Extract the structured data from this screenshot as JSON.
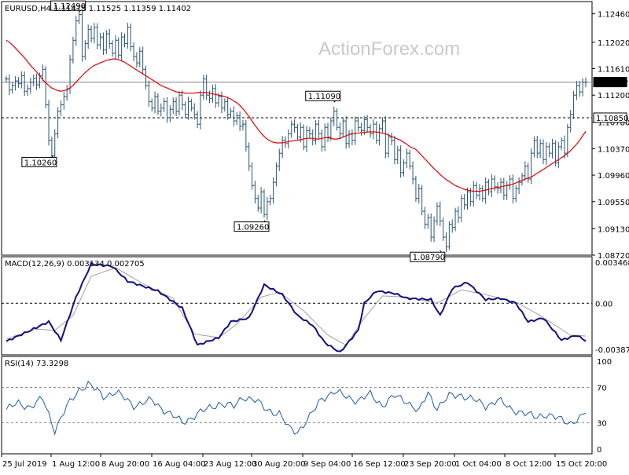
{
  "chart_data": [
    {
      "type": "ohlc",
      "panel": "price",
      "symbol_header": "EURUSD,H4  1.11475 1.11525 1.11359 1.11402",
      "watermark": "ActionForex.com",
      "ylim": [
        1.0872,
        1.1265
      ],
      "y_ticks": [
        1.1246,
        1.1202,
        1.1161,
        1.112,
        1.1078,
        1.1037,
        1.0996,
        1.0955,
        1.0913,
        1.0872
      ],
      "y_tick_labels": [
        "1.12460",
        "1.12020",
        "1.11610",
        "1.11200",
        "1.10780",
        "1.10370",
        "1.09960",
        "1.09550",
        "1.09130",
        "1.08720"
      ],
      "x_tick_labels": [
        "25 Jul 2019",
        "1 Aug 12:00",
        "8 Aug 20:00",
        "16 Aug 04:00",
        "23 Aug 12:00",
        "30 Aug 20:00",
        "9 Sep 04:00",
        "16 Sep 12:00",
        "23 Sep 20:00",
        "1 Oct 04:00",
        "8 Oct 12:00",
        "15 Oct 20:00"
      ],
      "price_tags": [
        {
          "label": "1.11402",
          "value": 1.11402,
          "style": "filled"
        },
        {
          "label": "1.10850",
          "value": 1.1085,
          "style": "outline"
        }
      ],
      "horizontal_lines": [
        {
          "value": 1.11402,
          "style": "solid",
          "color": "#808080"
        },
        {
          "value": 1.1085,
          "style": "dashed",
          "color": "#000000"
        }
      ],
      "annotations": [
        {
          "label": "1.12490",
          "bar": 24,
          "value": 1.1249
        },
        {
          "label": "1.10260",
          "bar": 15,
          "value": 1.1026
        },
        {
          "label": "1.09260",
          "bar": 85,
          "value": 1.0926
        },
        {
          "label": "1.11090",
          "bar": 108,
          "value": 1.1109
        },
        {
          "label": "1.08790",
          "bar": 143,
          "value": 1.0879
        }
      ],
      "ma_color": "#e00000",
      "bar_color": "#2b5573",
      "close_series": [
        1.1145,
        1.1128,
        1.1135,
        1.1142,
        1.1138,
        1.115,
        1.1126,
        1.113,
        1.114,
        1.1146,
        1.1136,
        1.115,
        1.116,
        1.1105,
        1.105,
        1.1026,
        1.106,
        1.1095,
        1.1105,
        1.1118,
        1.113,
        1.1175,
        1.1205,
        1.1235,
        1.1245,
        1.118,
        1.12,
        1.1222,
        1.1208,
        1.1225,
        1.1198,
        1.121,
        1.119,
        1.1215,
        1.12,
        1.1185,
        1.1205,
        1.1182,
        1.121,
        1.12,
        1.1225,
        1.1195,
        1.118,
        1.117,
        1.1188,
        1.116,
        1.1135,
        1.111,
        1.11,
        1.1118,
        1.1095,
        1.11,
        1.111,
        1.1085,
        1.1098,
        1.111,
        1.1095,
        1.112,
        1.1105,
        1.109,
        1.111,
        1.11,
        1.109,
        1.1075,
        1.112,
        1.1145,
        1.112,
        1.1115,
        1.113,
        1.1108,
        1.1118,
        1.11,
        1.111,
        1.109,
        1.1095,
        1.108,
        1.1088,
        1.1072,
        1.1075,
        1.104,
        1.101,
        1.098,
        1.096,
        1.0945,
        1.097,
        1.0935,
        1.0955,
        1.096,
        1.0985,
        1.101,
        1.103,
        1.105,
        1.1045,
        1.106,
        1.1075,
        1.107,
        1.1055,
        1.107,
        1.104,
        1.1065,
        1.106,
        1.105,
        1.1075,
        1.106,
        1.104,
        1.107,
        1.1055,
        1.108,
        1.1095,
        1.107,
        1.106,
        1.108,
        1.1045,
        1.106,
        1.105,
        1.108,
        1.107,
        1.1065,
        1.1082,
        1.107,
        1.106,
        1.1075,
        1.105,
        1.1068,
        1.108,
        1.103,
        1.1055,
        1.105,
        1.102,
        1.1035,
        1.1,
        1.1015,
        1.103,
        1.101,
        1.099,
        1.096,
        1.0975,
        1.094,
        1.092,
        1.093,
        1.09,
        1.0925,
        1.0948,
        1.0925,
        1.09,
        1.0885,
        1.092,
        1.0915,
        1.094,
        1.093,
        1.096,
        1.095,
        1.097,
        1.0955,
        1.098,
        1.0965,
        1.0975,
        1.096,
        1.0985,
        1.097,
        1.099,
        1.0978,
        1.0975,
        1.0985,
        1.0965,
        1.098,
        1.099,
        1.096,
        1.0975,
        1.0985,
        1.0995,
        1.101,
        1.099,
        1.103,
        1.105,
        1.103,
        1.1045,
        1.102,
        1.104,
        1.103,
        1.1045,
        1.1015,
        1.104,
        1.105,
        1.103,
        1.107,
        1.109,
        1.112,
        1.1135,
        1.1125,
        1.114,
        1.11402
      ],
      "ma_series": [
        1.1205,
        1.1202,
        1.1198,
        1.1193,
        1.1188,
        1.1183,
        1.1178,
        1.1172,
        1.1166,
        1.1161,
        1.1156,
        1.115,
        1.1144,
        1.1139,
        1.1135,
        1.1131,
        1.1129,
        1.1127,
        1.1126,
        1.1128,
        1.1131,
        1.1135,
        1.114,
        1.1145,
        1.115,
        1.1155,
        1.1159,
        1.1163,
        1.1166,
        1.1168,
        1.117,
        1.1172,
        1.1174,
        1.1175,
        1.1176,
        1.1176,
        1.1175,
        1.1173,
        1.1171,
        1.1168,
        1.1165,
        1.1162,
        1.1159,
        1.1156,
        1.1153,
        1.115,
        1.1147,
        1.1144,
        1.1141,
        1.1138,
        1.1135,
        1.1133,
        1.1131,
        1.1129,
        1.1127,
        1.1125,
        1.1124,
        1.1123,
        1.1123,
        1.1123,
        1.1123,
        1.1124,
        1.1124,
        1.1124,
        1.1124,
        1.1123,
        1.1122,
        1.1121,
        1.112,
        1.1119,
        1.1118,
        1.1116,
        1.1114,
        1.1111,
        1.1108,
        1.1104,
        1.1099,
        1.1093,
        1.1087,
        1.108,
        1.1073,
        1.1067,
        1.1061,
        1.1056,
        1.1052,
        1.1049,
        1.1047,
        1.1046,
        1.1046,
        1.1046,
        1.1047,
        1.1048,
        1.1049,
        1.105,
        1.1051,
        1.1052,
        1.1053,
        1.1053,
        1.1053,
        1.1052,
        1.1052,
        1.1053,
        1.1054,
        1.1054,
        1.1053,
        1.1052,
        1.1052,
        1.1053,
        1.1055,
        1.1057,
        1.1059,
        1.106,
        1.1061,
        1.1061,
        1.1062,
        1.1062,
        1.1063,
        1.1063,
        1.1063,
        1.1063,
        1.1062,
        1.1061,
        1.106,
        1.1058,
        1.1056,
        1.1054,
        1.1052,
        1.105,
        1.1047,
        1.1044,
        1.104,
        1.1036,
        1.1031,
        1.1026,
        1.1021,
        1.1016,
        1.1011,
        1.1006,
        1.1002,
        1.0997,
        1.0993,
        1.0989,
        1.0986,
        1.0983,
        1.098,
        1.0978,
        1.0976,
        1.0974,
        1.0973,
        1.0972,
        1.0971,
        1.0971,
        1.0971,
        1.0972,
        1.0973,
        1.0974,
        1.0975,
        1.0976,
        1.0977,
        1.0978,
        1.0979,
        1.098,
        1.0981,
        1.0982,
        1.0984,
        1.0986,
        1.0988,
        1.099,
        1.0993,
        1.0996,
        1.0999,
        1.1002,
        1.1005,
        1.1008,
        1.1011,
        1.1014,
        1.1017,
        1.102,
        1.1023,
        1.1026,
        1.103,
        1.1034,
        1.1039,
        1.1044,
        1.105,
        1.1057,
        1.1064
      ]
    },
    {
      "type": "line",
      "panel": "macd",
      "header": "MACD(12,26,9) 0.003134 0.002705",
      "ylim": [
        -0.003879,
        0.003468
      ],
      "y_tick_labels": [
        "0.003468",
        "0.00",
        "-0.003879"
      ],
      "main_color": "#101080",
      "signal_color": "#a0a0a0",
      "main_keypoints": [
        [
          0,
          -0.0031
        ],
        [
          8,
          -0.0022
        ],
        [
          14,
          -0.0015
        ],
        [
          18,
          -0.003
        ],
        [
          23,
          0.0005
        ],
        [
          28,
          0.0032
        ],
        [
          35,
          0.003
        ],
        [
          40,
          0.0018
        ],
        [
          50,
          0.001
        ],
        [
          58,
          -0.0004
        ],
        [
          63,
          -0.0034
        ],
        [
          70,
          -0.0028
        ],
        [
          74,
          -0.0015
        ],
        [
          80,
          -0.0012
        ],
        [
          85,
          0.0015
        ],
        [
          91,
          0.0007
        ],
        [
          96,
          -0.001
        ],
        [
          101,
          -0.0018
        ],
        [
          105,
          -0.0032
        ],
        [
          110,
          -0.004
        ],
        [
          116,
          -0.0022
        ],
        [
          118,
          0.0
        ],
        [
          122,
          0.001
        ],
        [
          128,
          0.0008
        ],
        [
          132,
          0.0004
        ],
        [
          140,
          0.0003
        ],
        [
          143,
          -0.001
        ],
        [
          147,
          0.0012
        ],
        [
          152,
          0.0017
        ],
        [
          158,
          0.0003
        ],
        [
          163,
          0.0004
        ],
        [
          168,
          0.0
        ],
        [
          172,
          -0.0015
        ],
        [
          177,
          -0.0012
        ],
        [
          183,
          -0.003
        ],
        [
          188,
          -0.0026
        ],
        [
          192,
          -0.0032
        ],
        [
          196,
          -0.0022
        ],
        [
          200,
          -0.0004
        ],
        [
          205,
          0.0015
        ],
        [
          212,
          0.0012
        ],
        [
          220,
          0.0009
        ],
        [
          225,
          0.0004
        ],
        [
          232,
          0.0018
        ],
        [
          238,
          0.0007
        ],
        [
          245,
          0.003
        ],
        [
          250,
          0.0034
        ]
      ],
      "signal_keypoints": [
        [
          0,
          -0.0029
        ],
        [
          10,
          -0.0021
        ],
        [
          16,
          -0.0022
        ],
        [
          22,
          -0.001
        ],
        [
          28,
          0.0022
        ],
        [
          36,
          0.0029
        ],
        [
          45,
          0.0016
        ],
        [
          55,
          0.0004
        ],
        [
          62,
          -0.0025
        ],
        [
          70,
          -0.0028
        ],
        [
          76,
          -0.0017
        ],
        [
          84,
          0.0005
        ],
        [
          90,
          0.0009
        ],
        [
          98,
          -0.0006
        ],
        [
          106,
          -0.0026
        ],
        [
          112,
          -0.0034
        ],
        [
          118,
          -0.0012
        ],
        [
          124,
          0.0006
        ],
        [
          132,
          0.0005
        ],
        [
          142,
          0.0
        ],
        [
          150,
          0.0011
        ],
        [
          158,
          0.0007
        ],
        [
          168,
          0.0001
        ],
        [
          176,
          -0.001
        ],
        [
          186,
          -0.0026
        ],
        [
          194,
          -0.0027
        ],
        [
          200,
          -0.001
        ],
        [
          208,
          0.0012
        ],
        [
          220,
          0.001
        ],
        [
          228,
          0.0008
        ],
        [
          238,
          0.0012
        ],
        [
          250,
          0.0027
        ]
      ]
    },
    {
      "type": "line",
      "panel": "rsi",
      "header": "RSI(14) 73.3298",
      "ylim": [
        0,
        100
      ],
      "y_tick_labels": [
        "100",
        "70",
        "30",
        "0"
      ],
      "levels": [
        70,
        30
      ],
      "line_color": "#1e5aa8",
      "keypoints": [
        [
          0,
          45
        ],
        [
          4,
          52
        ],
        [
          8,
          48
        ],
        [
          12,
          57
        ],
        [
          16,
          22
        ],
        [
          20,
          48
        ],
        [
          24,
          68
        ],
        [
          27,
          74
        ],
        [
          32,
          60
        ],
        [
          36,
          65
        ],
        [
          42,
          50
        ],
        [
          48,
          55
        ],
        [
          54,
          40
        ],
        [
          58,
          30
        ],
        [
          62,
          38
        ],
        [
          66,
          45
        ],
        [
          70,
          52
        ],
        [
          75,
          48
        ],
        [
          78,
          60
        ],
        [
          82,
          55
        ],
        [
          86,
          45
        ],
        [
          90,
          40
        ],
        [
          93,
          24
        ],
        [
          96,
          20
        ],
        [
          100,
          36
        ],
        [
          104,
          58
        ],
        [
          108,
          65
        ],
        [
          112,
          60
        ],
        [
          116,
          55
        ],
        [
          120,
          62
        ],
        [
          124,
          50
        ],
        [
          128,
          60
        ],
        [
          132,
          55
        ],
        [
          136,
          42
        ],
        [
          139,
          64
        ],
        [
          142,
          47
        ],
        [
          146,
          60
        ],
        [
          150,
          62
        ],
        [
          154,
          56
        ],
        [
          158,
          49
        ],
        [
          162,
          56
        ],
        [
          166,
          46
        ],
        [
          170,
          42
        ],
        [
          174,
          36
        ],
        [
          178,
          40
        ],
        [
          182,
          34
        ],
        [
          186,
          30
        ],
        [
          190,
          37
        ],
        [
          194,
          52
        ],
        [
          198,
          50
        ],
        [
          202,
          60
        ],
        [
          206,
          64
        ],
        [
          210,
          58
        ],
        [
          215,
          56
        ],
        [
          220,
          62
        ],
        [
          225,
          60
        ],
        [
          230,
          70
        ],
        [
          234,
          66
        ],
        [
          238,
          74
        ],
        [
          242,
          72
        ],
        [
          246,
          77
        ],
        [
          250,
          73.3
        ]
      ]
    }
  ]
}
